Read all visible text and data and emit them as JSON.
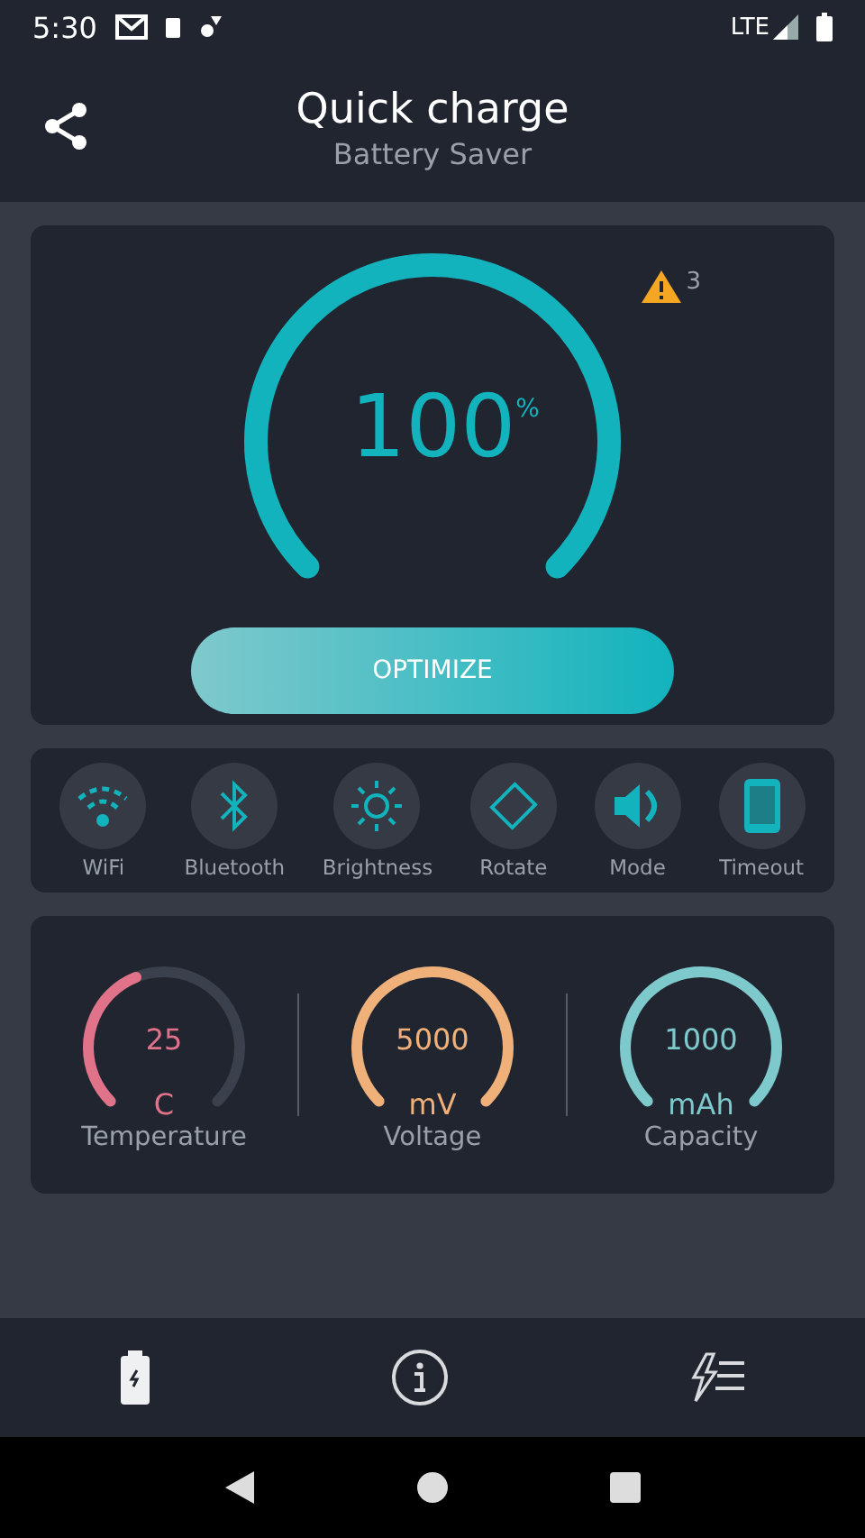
{
  "status_bar": {
    "time": "5:30",
    "network": "LTE"
  },
  "header": {
    "title": "Quick charge",
    "subtitle": "Battery Saver"
  },
  "charge": {
    "value": "100",
    "unit": "%",
    "warning_count": "3",
    "button": "OPTIMIZE"
  },
  "toggles": [
    {
      "label": "WiFi",
      "kind": "wifi"
    },
    {
      "label": "Bluetooth",
      "kind": "bluetooth"
    },
    {
      "label": "Brightness",
      "kind": "brightness"
    },
    {
      "label": "Rotate",
      "kind": "rotate"
    },
    {
      "label": "Mode",
      "kind": "mode"
    },
    {
      "label": "Timeout",
      "kind": "timeout"
    }
  ],
  "stats": [
    {
      "value": "25",
      "unit": "C",
      "label": "Temperature",
      "color": "#e0728a"
    },
    {
      "value": "5000",
      "unit": "mV",
      "label": "Voltage",
      "color": "#f0b07a"
    },
    {
      "value": "1000",
      "unit": "mAh",
      "label": "Capacity",
      "color": "#7ec9cc"
    }
  ],
  "bottom_nav": [
    {
      "kind": "battery",
      "selected": true
    },
    {
      "kind": "info",
      "selected": false
    },
    {
      "kind": "boost",
      "selected": false
    }
  ]
}
